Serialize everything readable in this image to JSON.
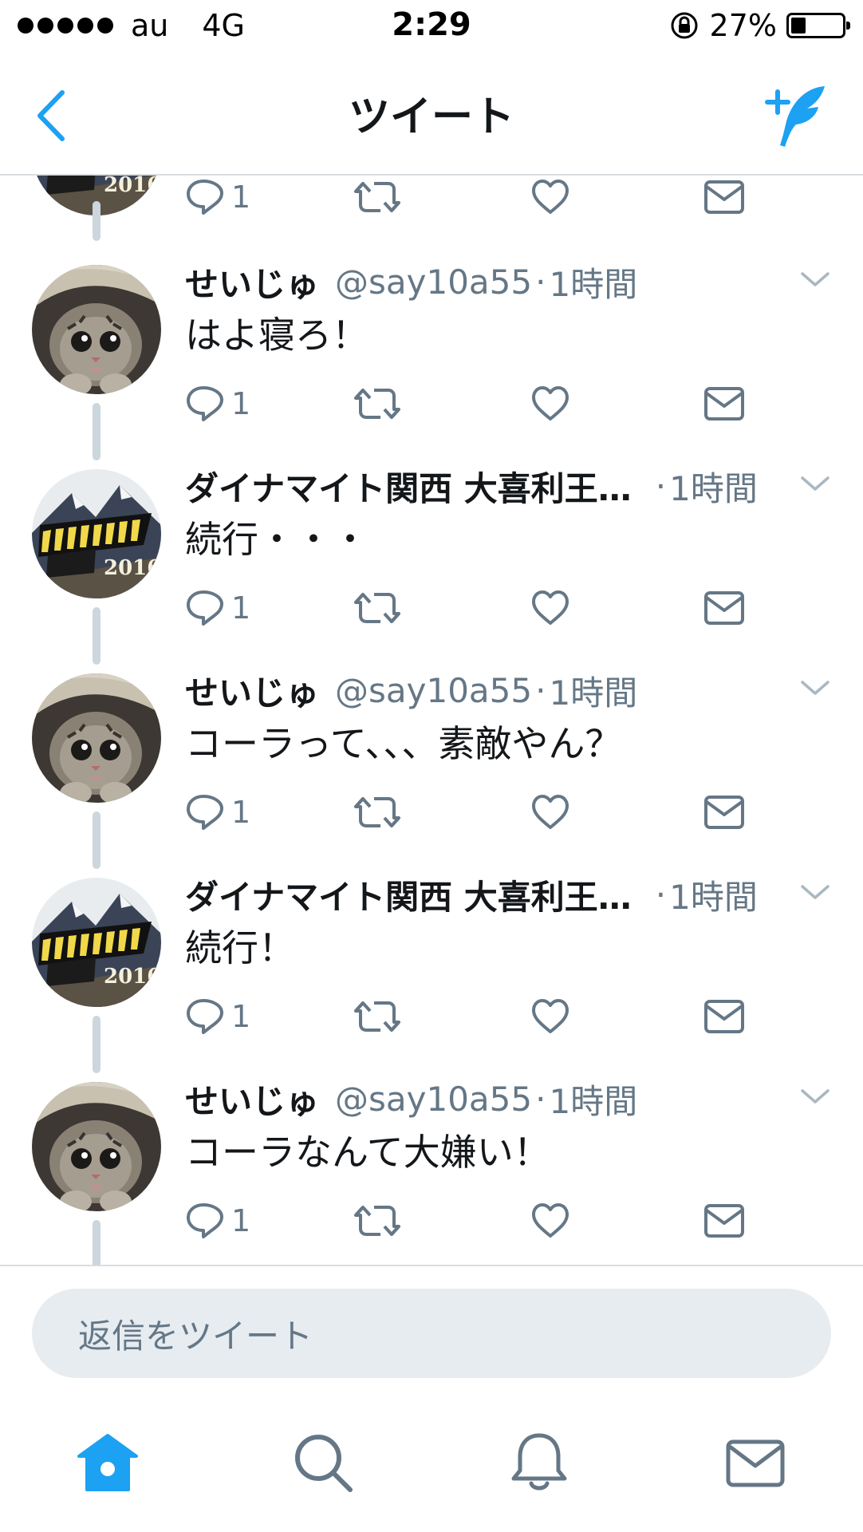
{
  "status_bar": {
    "carrier": "au",
    "network": "4G",
    "time": "2:29",
    "battery": "27%"
  },
  "nav": {
    "title": "ツイート"
  },
  "colors": {
    "accent": "#1da1f2",
    "icon": "#657786",
    "connector": "#ccd6dd"
  },
  "top_partial_actions": {
    "reply_count": "1"
  },
  "tweets": [
    {
      "name": "せいじゅ",
      "handle": "@say10a55",
      "sep": "·",
      "time": "1時間",
      "text": "はよ寝ろ！",
      "reply_count": "1"
    },
    {
      "name": "ダイナマイト関西 大喜利王…",
      "handle": "",
      "sep": "·",
      "time": "1時間",
      "text": "続行・・・",
      "reply_count": "1"
    },
    {
      "name": "せいじゅ",
      "handle": "@say10a55",
      "sep": "·",
      "time": "1時間",
      "text": "コーラって、、、素敵やん？",
      "reply_count": "1"
    },
    {
      "name": "ダイナマイト関西 大喜利王…",
      "handle": "",
      "sep": "·",
      "time": "1時間",
      "text": "続行！",
      "reply_count": "1"
    },
    {
      "name": "せいじゅ",
      "handle": "@say10a55",
      "sep": "·",
      "time": "1時間",
      "text": "コーラなんて大嫌い！",
      "reply_count": "1"
    }
  ],
  "reply": {
    "placeholder": "返信をツイート"
  },
  "tabs": [
    "home-icon",
    "search-icon",
    "notifications-icon",
    "messages-icon"
  ]
}
